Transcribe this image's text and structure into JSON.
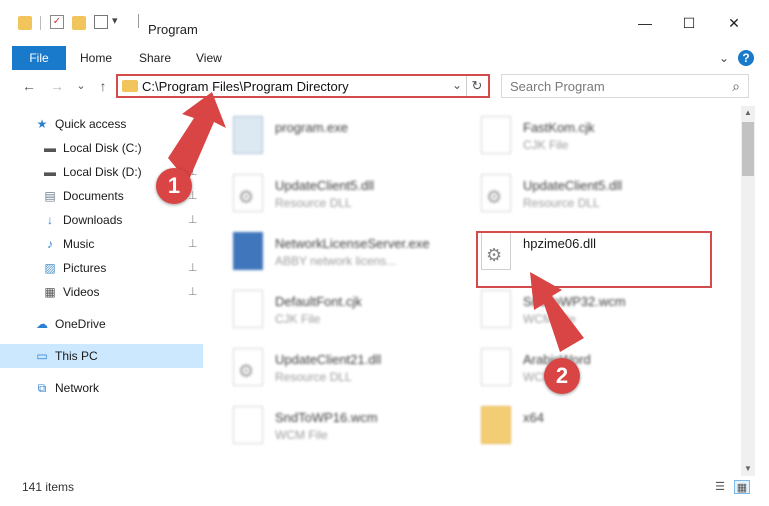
{
  "window": {
    "title": "Program",
    "minimize": "—",
    "maximize": "☐",
    "close": "✕"
  },
  "ribbon": {
    "tabs": [
      "File",
      "Home",
      "Share",
      "View"
    ],
    "collapse_glyph": "⌄",
    "help_glyph": "?"
  },
  "nav": {
    "back": "←",
    "forward": "→",
    "recent": "⌄",
    "up": "↑",
    "address": "C:\\Program Files\\Program Directory",
    "address_dropdown": "⌄",
    "refresh": "↻",
    "search_placeholder": "Search Program"
  },
  "sidebar": {
    "items": [
      {
        "label": "Quick access",
        "icon": "star-icon",
        "glyph": "★",
        "color": "#2d7fd1"
      },
      {
        "label": "Local Disk (C:)",
        "icon": "drive-icon",
        "glyph": "▬",
        "color": "#555555"
      },
      {
        "label": "Local Disk (D:)",
        "icon": "drive-icon",
        "glyph": "▬",
        "color": "#555555",
        "pinned": true
      },
      {
        "label": "Documents",
        "icon": "documents-icon",
        "glyph": "▤",
        "color": "#6b7b8c",
        "pinned": true
      },
      {
        "label": "Downloads",
        "icon": "downloads-icon",
        "glyph": "↓",
        "color": "#2d7fd1",
        "pinned": true
      },
      {
        "label": "Music",
        "icon": "music-icon",
        "glyph": "♪",
        "color": "#2d7fd1",
        "pinned": true
      },
      {
        "label": "Pictures",
        "icon": "pictures-icon",
        "glyph": "▨",
        "color": "#4a90c8",
        "pinned": true
      },
      {
        "label": "Videos",
        "icon": "videos-icon",
        "glyph": "▦",
        "color": "#555555",
        "pinned": true
      },
      {
        "label": "OneDrive",
        "icon": "cloud-icon",
        "glyph": "☁",
        "color": "#2d7fd1"
      },
      {
        "label": "This PC",
        "icon": "computer-icon",
        "glyph": "▭",
        "color": "#2d7fd1",
        "selected": true
      },
      {
        "label": "Network",
        "icon": "network-icon",
        "glyph": "⧉",
        "color": "#2d7fd1"
      }
    ],
    "pin_glyph": "📌"
  },
  "files": [
    {
      "name": "program.exe",
      "type": "",
      "icon": "exe"
    },
    {
      "name": "FastKom.cjk",
      "type": "CJK File",
      "icon": "doc"
    },
    {
      "name": "UpdateClient5.dll",
      "type": "Resource DLL",
      "icon": "gear"
    },
    {
      "name": "UpdateClient5.dll",
      "type": "Resource DLL",
      "icon": "gear"
    },
    {
      "name": "NetworkLicenseServer.exe",
      "type": "ABBY network licens...",
      "icon": "exe2"
    },
    {
      "name": "hpzime06.dll",
      "type": "",
      "icon": "gear",
      "highlighted": true
    },
    {
      "name": "DefaultFont.cjk",
      "type": "CJK File",
      "icon": "doc"
    },
    {
      "name": "SndToWP32.wcm",
      "type": "WCM File",
      "icon": "doc"
    },
    {
      "name": "UpdateClient21.dll",
      "type": "Resource DLL",
      "icon": "gear"
    },
    {
      "name": "ArabicWord",
      "type": "WCM File",
      "icon": "doc"
    },
    {
      "name": "SndToWP16.wcm",
      "type": "WCM File",
      "icon": "doc"
    },
    {
      "name": "x64",
      "type": "",
      "icon": "folder"
    }
  ],
  "callouts": [
    "1",
    "2"
  ],
  "status": {
    "item_count": "141 items",
    "details_view": "☰",
    "tiles_view": "▦"
  },
  "colors": {
    "accent": "#1979ca",
    "annotation": "#d94545",
    "selection": "#cce8ff"
  }
}
